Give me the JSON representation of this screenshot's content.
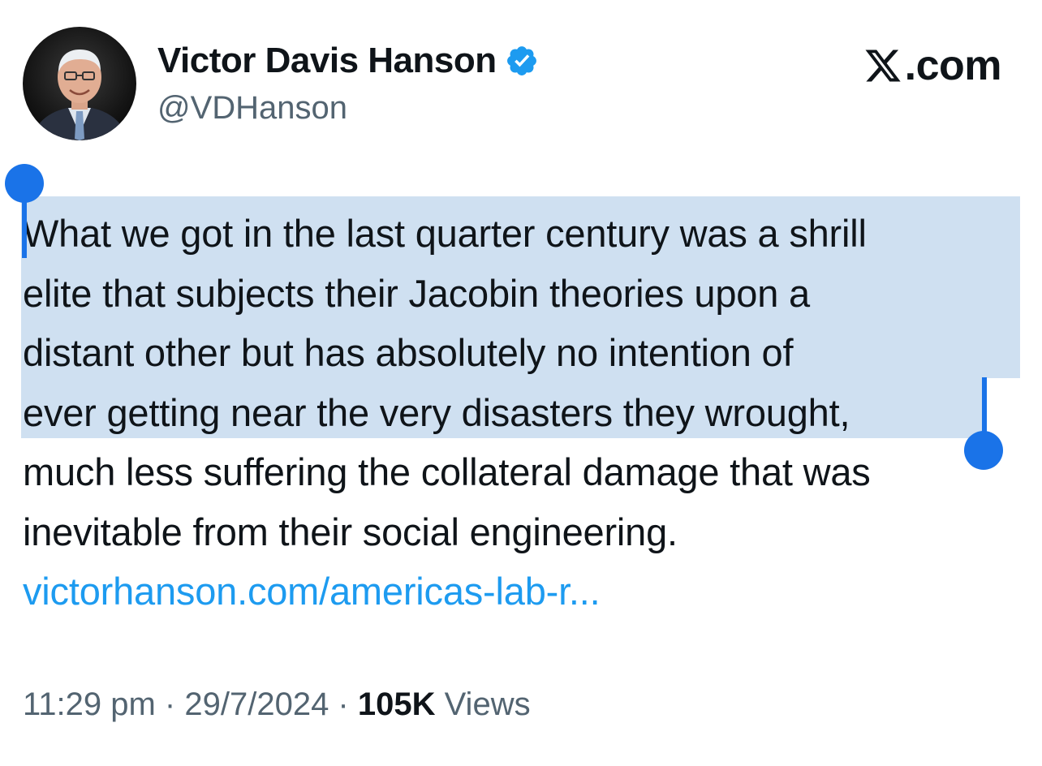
{
  "author": {
    "display_name": "Victor Davis Hanson",
    "handle": "@VDHanson",
    "verified_icon": "verified-badge-icon"
  },
  "brand": {
    "label": ".com",
    "icon": "x-logo-icon"
  },
  "tweet": {
    "lines": [
      "What we got in the last quarter century was a shrill",
      "elite that subjects their Jacobin theories upon a",
      "distant other but has absolutely no intention of",
      "ever getting near the very disasters they wrought,",
      "much less suffering the collateral damage that was",
      "inevitable from their social engineering."
    ],
    "link": "victorhanson.com/americas-lab-r..."
  },
  "meta": {
    "time": "11:29 pm",
    "separator": " · ",
    "date": "29/7/2024",
    "views_count": "105K",
    "views_label": " Views"
  },
  "colors": {
    "link": "#1d9bf0",
    "selection": "#cfe0f1",
    "selection_handle": "#1a73e8",
    "secondary_text": "#536471"
  }
}
